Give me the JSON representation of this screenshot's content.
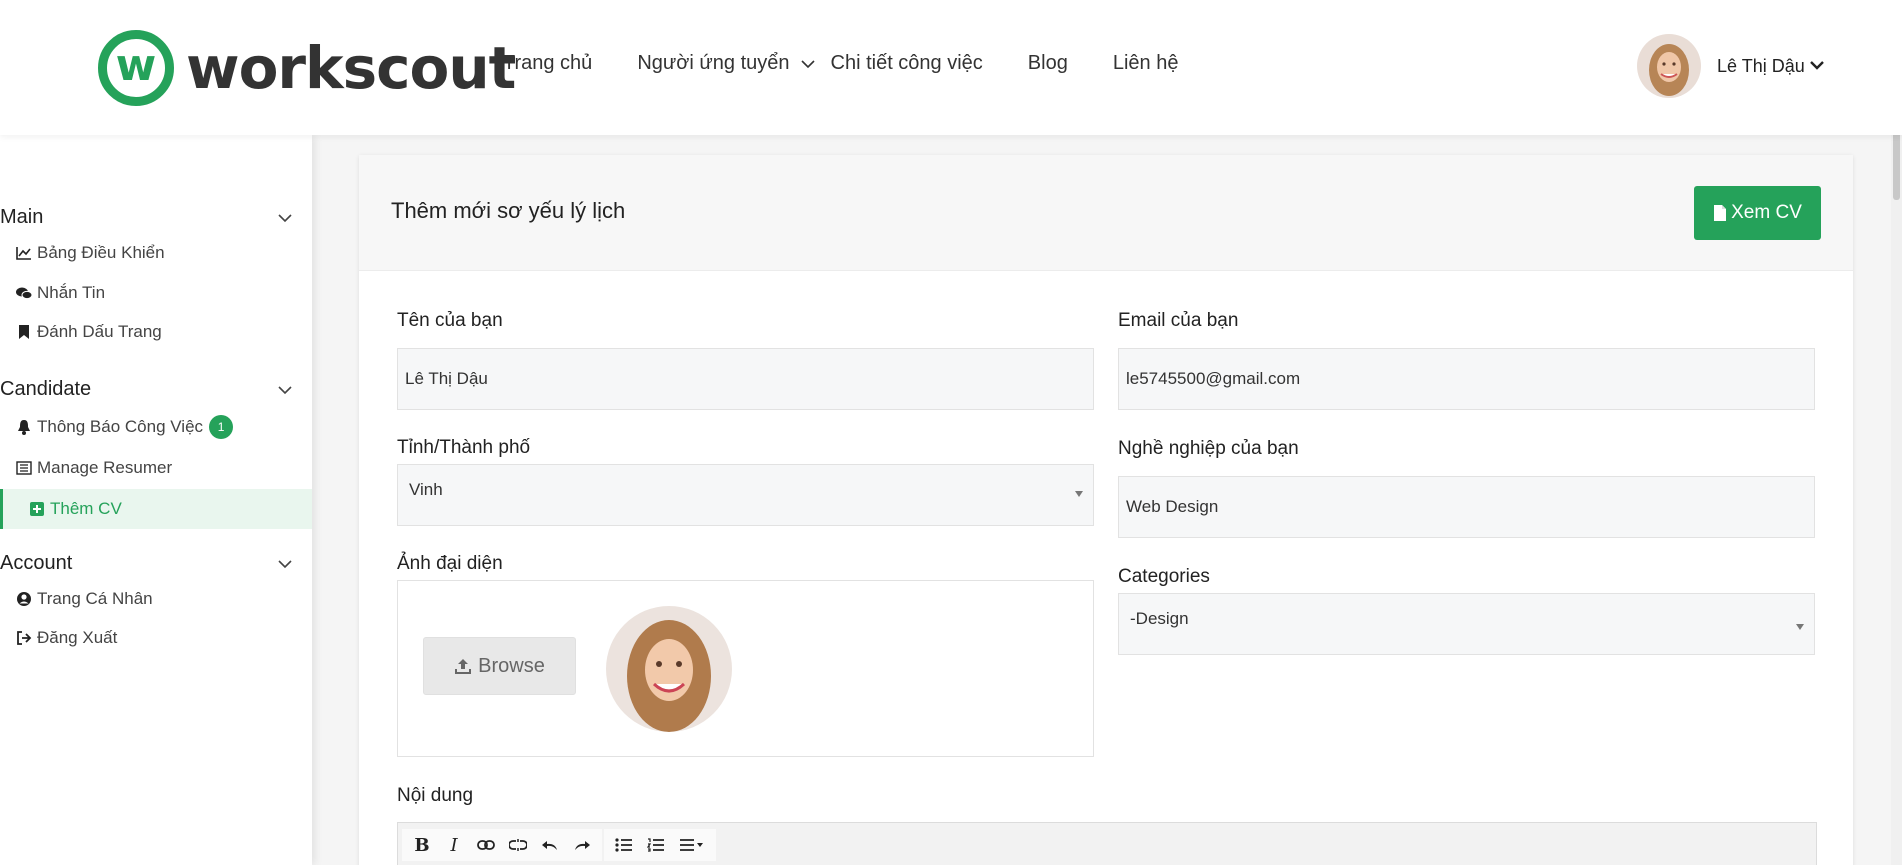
{
  "brand": {
    "logo_letter": "w",
    "name": "workscout",
    "accent": "#25a25a"
  },
  "nav": {
    "items": [
      {
        "label": "Trang chủ"
      },
      {
        "label": "Người ứng tuyển",
        "has_dropdown": true
      },
      {
        "label": "Chi tiết công việc"
      },
      {
        "label": "Blog"
      },
      {
        "label": "Liên hệ"
      }
    ]
  },
  "user": {
    "name": "Lê Thị Dậu"
  },
  "sidebar": {
    "sections": [
      {
        "title": "Main",
        "items": [
          {
            "label": "Bảng Điều Khiển",
            "icon": "chart-line-icon"
          },
          {
            "label": "Nhắn Tin",
            "icon": "chat-icon"
          },
          {
            "label": "Đánh Dấu Trang",
            "icon": "bookmark-icon"
          }
        ]
      },
      {
        "title": "Candidate",
        "items": [
          {
            "label": "Thông Báo Công Việc",
            "icon": "bell-icon",
            "badge": "1"
          },
          {
            "label": "Manage Resumer",
            "icon": "list-icon"
          },
          {
            "label": "Thêm CV",
            "icon": "plus-square-icon",
            "active": true
          }
        ]
      },
      {
        "title": "Account",
        "items": [
          {
            "label": "Trang Cá Nhân",
            "icon": "user-circle-icon"
          },
          {
            "label": "Đăng Xuất",
            "icon": "sign-out-icon"
          }
        ]
      }
    ]
  },
  "form": {
    "title": "Thêm mới sơ yếu lý lịch",
    "view_cv_label": "Xem CV",
    "name_label": "Tên của bạn",
    "name_value": "Lê Thị Dậu",
    "email_label": "Email của bạn",
    "email_value": "le5745500@gmail.com",
    "city_label": "Tỉnh/Thành phố",
    "city_value": "Vinh",
    "job_label": "Nghề nghiệp của bạn",
    "job_value": "Web Design",
    "avatar_label": "Ảnh đại diện",
    "browse_label": "Browse",
    "categories_label": "Categories",
    "categories_value": "-Design",
    "content_label": "Nội dung"
  }
}
